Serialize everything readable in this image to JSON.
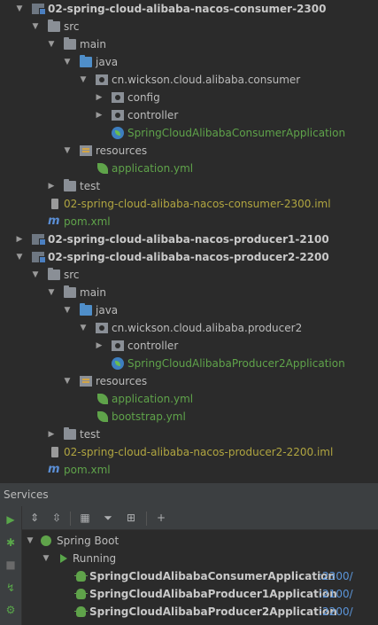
{
  "project_tree": {
    "consumer_module": "02-spring-cloud-alibaba-nacos-consumer-2300",
    "consumer_src": "src",
    "consumer_main": "main",
    "consumer_java": "java",
    "consumer_package": "cn.wickson.cloud.alibaba.consumer",
    "consumer_config": "config",
    "consumer_controller": "controller",
    "consumer_app": "SpringCloudAlibabaConsumerApplication",
    "consumer_resources": "resources",
    "consumer_app_yml": "application.yml",
    "consumer_test": "test",
    "consumer_iml": "02-spring-cloud-alibaba-nacos-consumer-2300.iml",
    "consumer_pom": "pom.xml",
    "producer1_module": "02-spring-cloud-alibaba-nacos-producer1-2100",
    "producer2_module": "02-spring-cloud-alibaba-nacos-producer2-2200",
    "producer2_src": "src",
    "producer2_main": "main",
    "producer2_java": "java",
    "producer2_package": "cn.wickson.cloud.alibaba.producer2",
    "producer2_controller": "controller",
    "producer2_app": "SpringCloudAlibabaProducer2Application",
    "producer2_resources": "resources",
    "producer2_app_yml": "application.yml",
    "producer2_bootstrap_yml": "bootstrap.yml",
    "producer2_test": "test",
    "producer2_iml": "02-spring-cloud-alibaba-nacos-producer2-2200.iml",
    "producer2_pom": "pom.xml"
  },
  "services": {
    "title": "Services",
    "spring_boot": "Spring Boot",
    "running": "Running",
    "apps": [
      {
        "name": "SpringCloudAlibabaConsumerApplication",
        "port": ":2300/"
      },
      {
        "name": "SpringCloudAlibabaProducer1Application",
        "port": ":2100/"
      },
      {
        "name": "SpringCloudAlibabaProducer2Application",
        "port": ":2200/"
      }
    ]
  },
  "colors": {
    "background": "#2b2b2b",
    "green_text": "#5fa34a",
    "yellow_text": "#b0a540",
    "port_blue": "#5b95d9"
  }
}
